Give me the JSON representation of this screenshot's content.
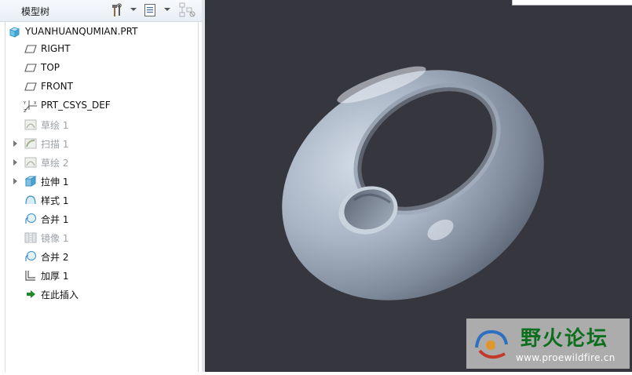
{
  "model_tree": {
    "title": "模型树",
    "toolbar": {
      "settings_icon": "hammer-wrench-icon",
      "show_icon": "list-document-icon",
      "filter_icon": "tree-filter-icon"
    },
    "items": [
      {
        "label": "YUANHUANQUMIAN.PRT",
        "icon": "part-icon",
        "dim": false,
        "expandable": false
      },
      {
        "label": "RIGHT",
        "icon": "datum-plane-icon",
        "dim": false,
        "expandable": false
      },
      {
        "label": "TOP",
        "icon": "datum-plane-icon",
        "dim": false,
        "expandable": false
      },
      {
        "label": "FRONT",
        "icon": "datum-plane-icon",
        "dim": false,
        "expandable": false
      },
      {
        "label": "PRT_CSYS_DEF",
        "icon": "coordinate-system-icon",
        "dim": false,
        "expandable": false
      },
      {
        "label": "草绘 1",
        "icon": "sketch-icon",
        "dim": true,
        "expandable": false
      },
      {
        "label": "扫描 1",
        "icon": "sweep-icon",
        "dim": true,
        "expandable": true
      },
      {
        "label": "草绘 2",
        "icon": "sketch-icon",
        "dim": true,
        "expandable": true
      },
      {
        "label": "拉伸 1",
        "icon": "extrude-icon",
        "dim": false,
        "expandable": true
      },
      {
        "label": "样式 1",
        "icon": "style-surface-icon",
        "dim": false,
        "expandable": false
      },
      {
        "label": "合并 1",
        "icon": "merge-icon",
        "dim": false,
        "expandable": false
      },
      {
        "label": "镜像 1",
        "icon": "mirror-icon",
        "dim": true,
        "expandable": false
      },
      {
        "label": "合并 2",
        "icon": "merge-icon",
        "dim": false,
        "expandable": false
      },
      {
        "label": "加厚 1",
        "icon": "thicken-icon",
        "dim": false,
        "expandable": false
      },
      {
        "label": "在此插入",
        "icon": "insert-here-arrow-icon",
        "dim": false,
        "expandable": false
      }
    ]
  },
  "watermark": {
    "title": "野火论坛",
    "url": "www.proewildfire.cn"
  },
  "colors": {
    "viewport_background": "#36363e",
    "model_surface": "#a9b5c5",
    "watermark_title": "#0d6f1e"
  }
}
